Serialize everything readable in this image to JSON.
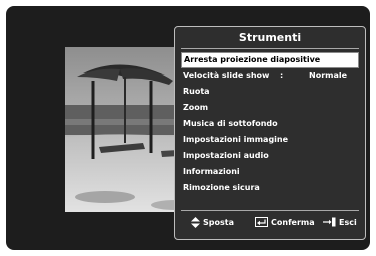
{
  "menu": {
    "title": "Strumenti",
    "items": [
      {
        "label": "Arresta proiezione diapositive",
        "selected": true
      },
      {
        "label": "Velocità slide show",
        "colon": ":",
        "value": "Normale"
      },
      {
        "label": "Ruota"
      },
      {
        "label": "Zoom"
      },
      {
        "label": "Musica di sottofondo"
      },
      {
        "label": "Impostazioni immagine"
      },
      {
        "label": "Impostazioni audio"
      },
      {
        "label": "Informazioni"
      },
      {
        "label": "Rimozione sicura"
      }
    ]
  },
  "footer": {
    "move_label": "Sposta",
    "confirm_label": "Conferma",
    "exit_label": "Esci",
    "move_icon": "up-down-arrows-icon",
    "confirm_icon": "enter-icon",
    "exit_icon": "exit-icon"
  },
  "colors": {
    "screen_background": "#1d1d1d",
    "panel_background": "#2e2e2e",
    "selected_background": "#ffffff",
    "text": "#ffffff"
  }
}
